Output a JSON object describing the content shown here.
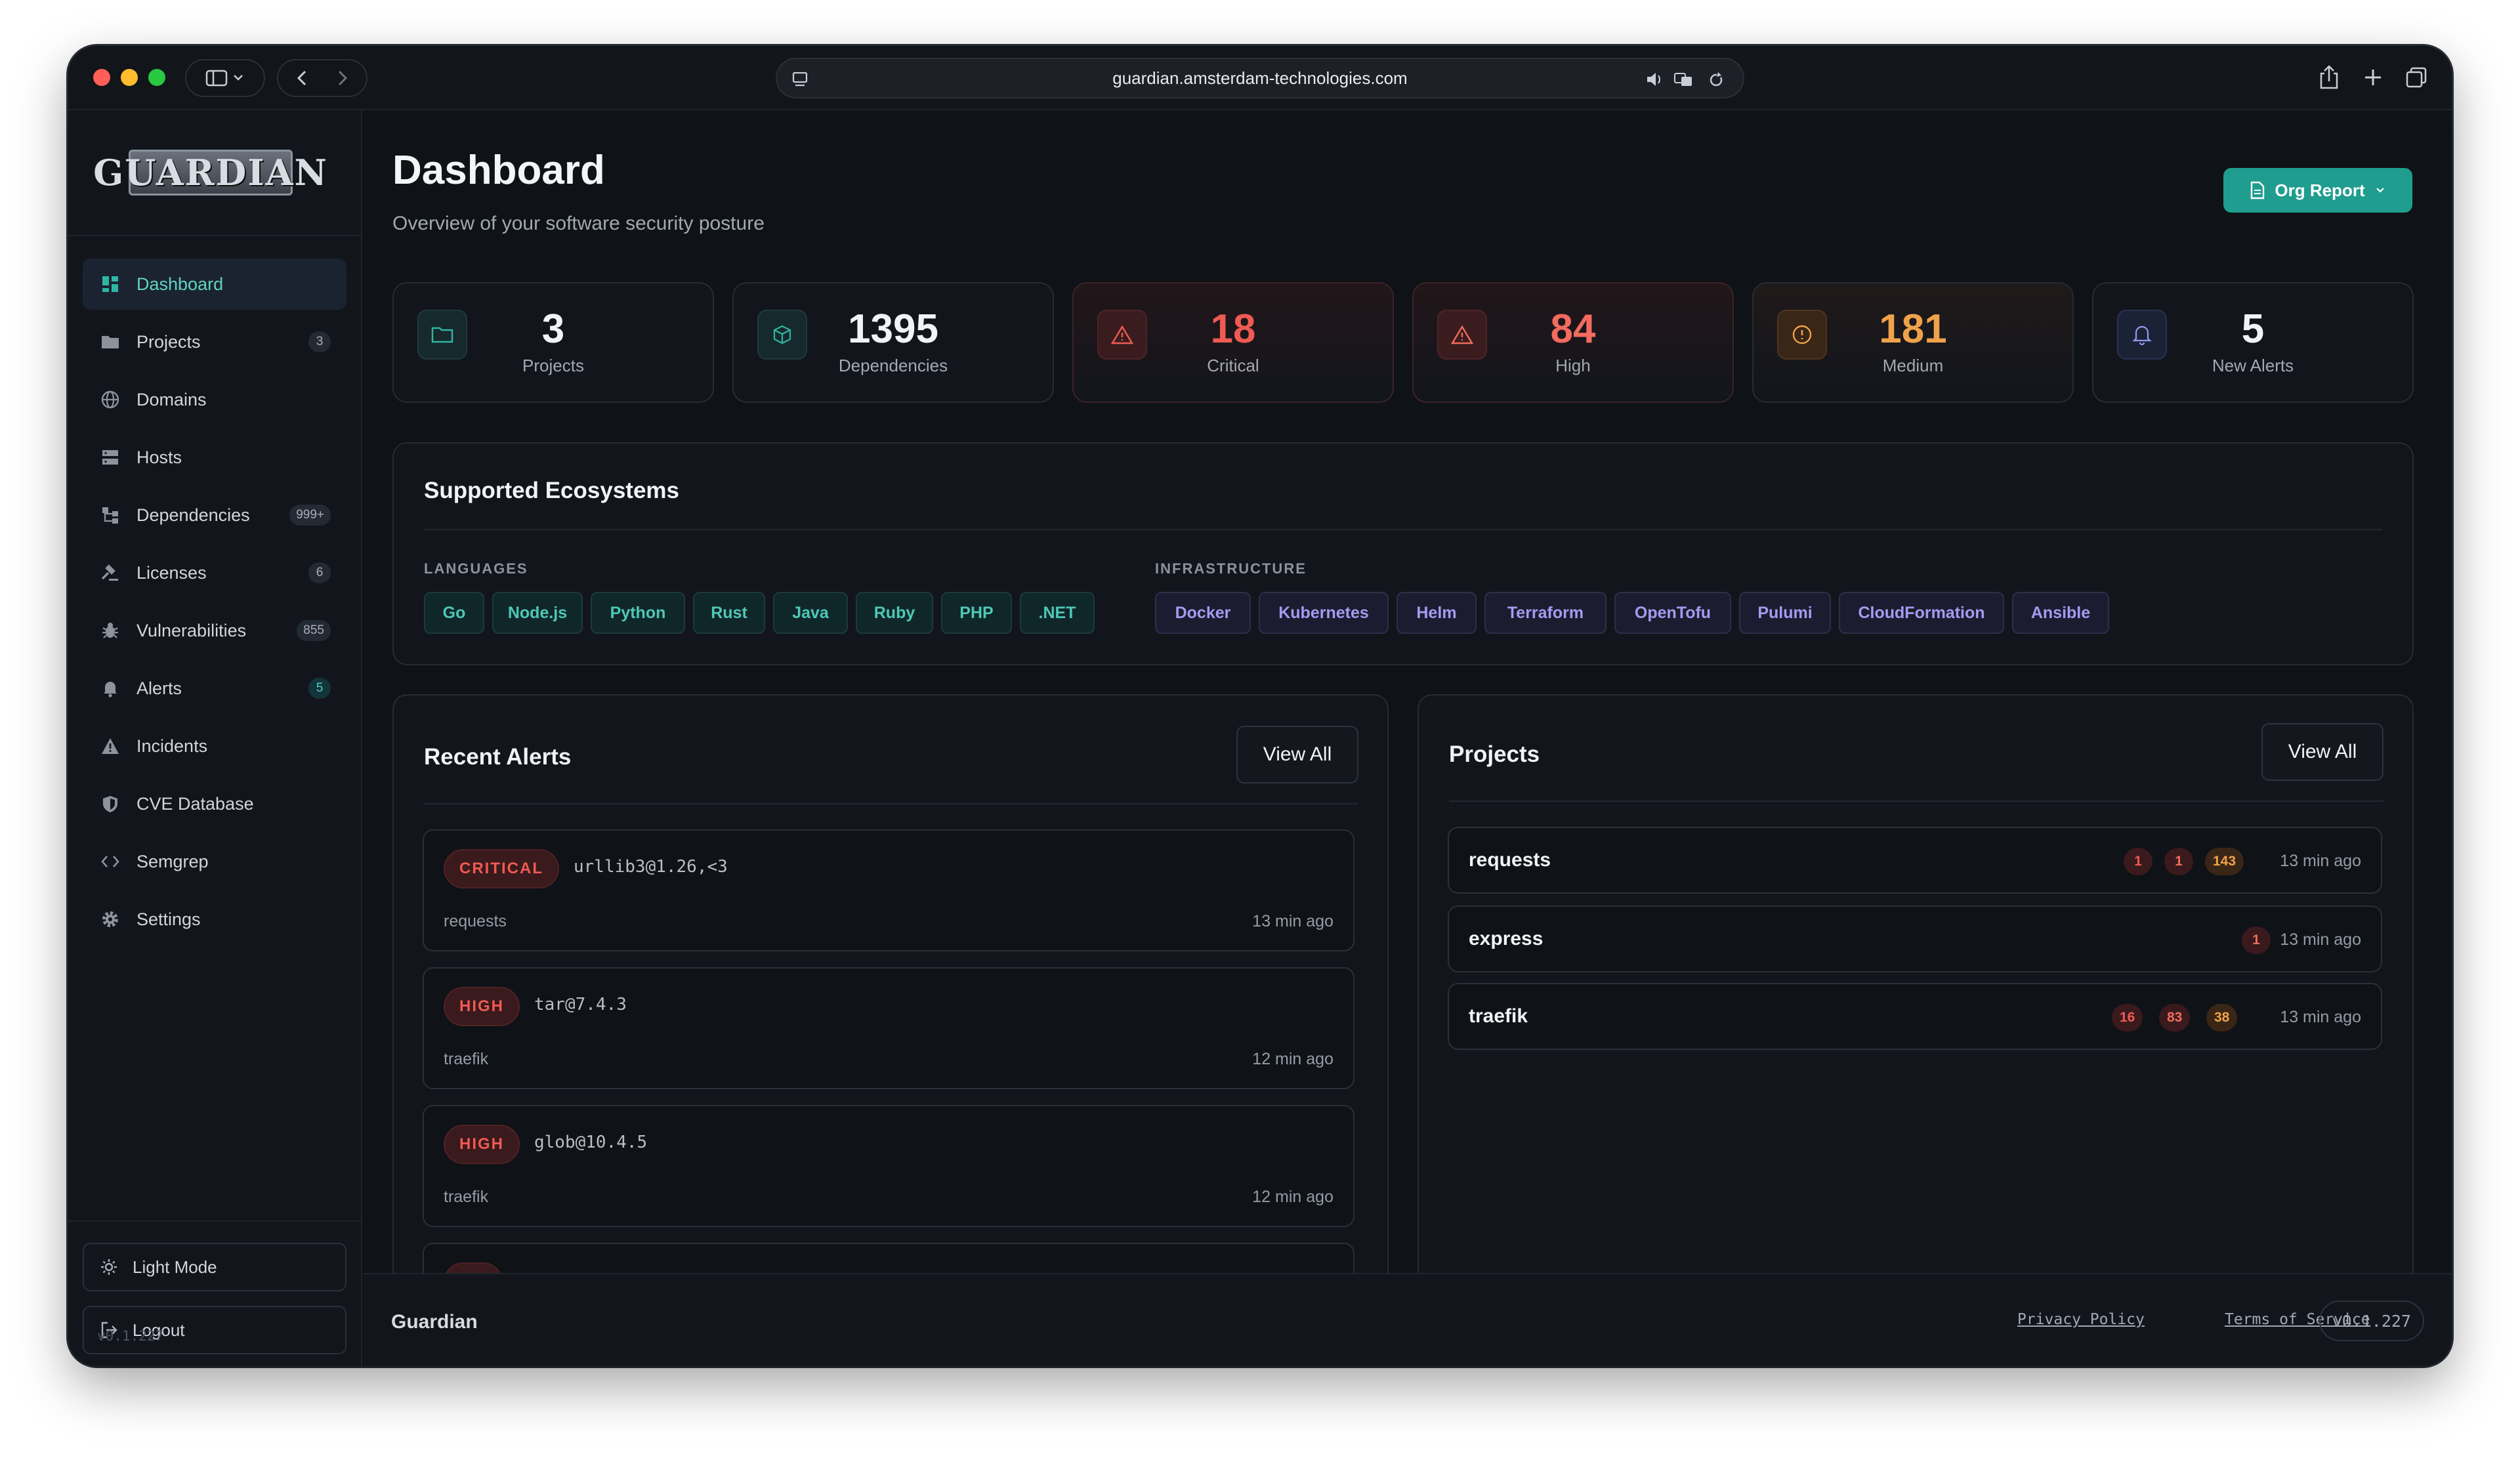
{
  "browser": {
    "url": "guardian.amsterdam-technologies.com"
  },
  "sidebar": {
    "logo": "GUARDIAN",
    "items": [
      {
        "label": "Dashboard",
        "icon": "grid-icon",
        "active": true
      },
      {
        "label": "Projects",
        "icon": "folder-icon",
        "badge": "3"
      },
      {
        "label": "Domains",
        "icon": "globe-icon"
      },
      {
        "label": "Hosts",
        "icon": "server-icon"
      },
      {
        "label": "Dependencies",
        "icon": "network-icon",
        "badge": "999+"
      },
      {
        "label": "Licenses",
        "icon": "gavel-icon",
        "badge": "6"
      },
      {
        "label": "Vulnerabilities",
        "icon": "bug-icon",
        "badge": "855"
      },
      {
        "label": "Alerts",
        "icon": "bell-icon",
        "badge": "5"
      },
      {
        "label": "Incidents",
        "icon": "warning-icon"
      },
      {
        "label": "CVE Database",
        "icon": "shield-icon"
      },
      {
        "label": "Semgrep",
        "icon": "code-icon"
      },
      {
        "label": "Settings",
        "icon": "gear-icon"
      }
    ],
    "light_mode": "Light Mode",
    "logout": "Logout",
    "version": "v0.1.227"
  },
  "header": {
    "title": "Dashboard",
    "subtitle": "Overview of your software security posture",
    "org_report": "Org Report"
  },
  "stats": [
    {
      "value": "3",
      "label": "Projects",
      "icon": "folder-icon"
    },
    {
      "value": "1395",
      "label": "Dependencies",
      "icon": "package-icon"
    },
    {
      "value": "18",
      "label": "Critical",
      "icon": "warning-icon"
    },
    {
      "value": "84",
      "label": "High",
      "icon": "warning-icon"
    },
    {
      "value": "181",
      "label": "Medium",
      "icon": "info-circle-icon"
    },
    {
      "value": "5",
      "label": "New Alerts",
      "icon": "bell-icon"
    }
  ],
  "colors": {
    "accent": "#1f9d8f",
    "critical": "#ef5a53",
    "medium": "#f0a24a"
  },
  "ecosystems": {
    "title": "Supported Ecosystems",
    "languages_label": "LANGUAGES",
    "languages": [
      "Go",
      "Node.js",
      "Python",
      "Rust",
      "Java",
      "Ruby",
      "PHP",
      ".NET"
    ],
    "infrastructure_label": "INFRASTRUCTURE",
    "infrastructure": [
      "Docker",
      "Kubernetes",
      "Helm",
      "Terraform",
      "OpenTofu",
      "Pulumi",
      "CloudFormation",
      "Ansible"
    ]
  },
  "recent_alerts": {
    "title": "Recent Alerts",
    "view_all": "View All",
    "items": [
      {
        "severity": "CRITICAL",
        "package": "urllib3@1.26,<3",
        "project": "requests",
        "time": "13 min ago"
      },
      {
        "severity": "HIGH",
        "package": "tar@7.4.3",
        "project": "traefik",
        "time": "12 min ago"
      },
      {
        "severity": "HIGH",
        "package": "glob@10.4.5",
        "project": "traefik",
        "time": "12 min ago"
      }
    ]
  },
  "projects": {
    "title": "Projects",
    "view_all": "View All",
    "items": [
      {
        "name": "requests",
        "counts": [
          "1",
          "1",
          "143"
        ],
        "time": "13 min ago"
      },
      {
        "name": "express",
        "counts": [
          "1"
        ],
        "time": "13 min ago"
      },
      {
        "name": "traefik",
        "counts": [
          "16",
          "83",
          "38"
        ],
        "time": "13 min ago"
      }
    ]
  },
  "footer": {
    "brand": "Guardian",
    "privacy": "Privacy Policy",
    "terms": "Terms of Service",
    "version": "v0.1.227"
  }
}
